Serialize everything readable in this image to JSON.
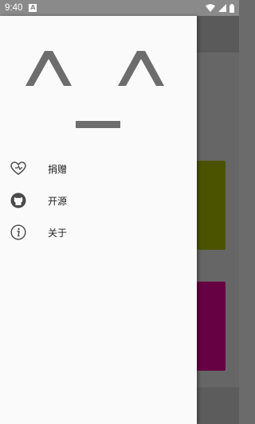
{
  "status_bar": {
    "time": "9:40",
    "notification_icon": "A"
  },
  "drawer": {
    "face_text": "^_^",
    "menu": [
      {
        "icon": "heart-outline-icon",
        "label": "捐赠"
      },
      {
        "icon": "github-icon",
        "label": "开源"
      },
      {
        "icon": "info-icon",
        "label": "关于"
      }
    ]
  },
  "background_cards": [
    {
      "color": "#4b5300"
    },
    {
      "color": "#660144"
    }
  ]
}
